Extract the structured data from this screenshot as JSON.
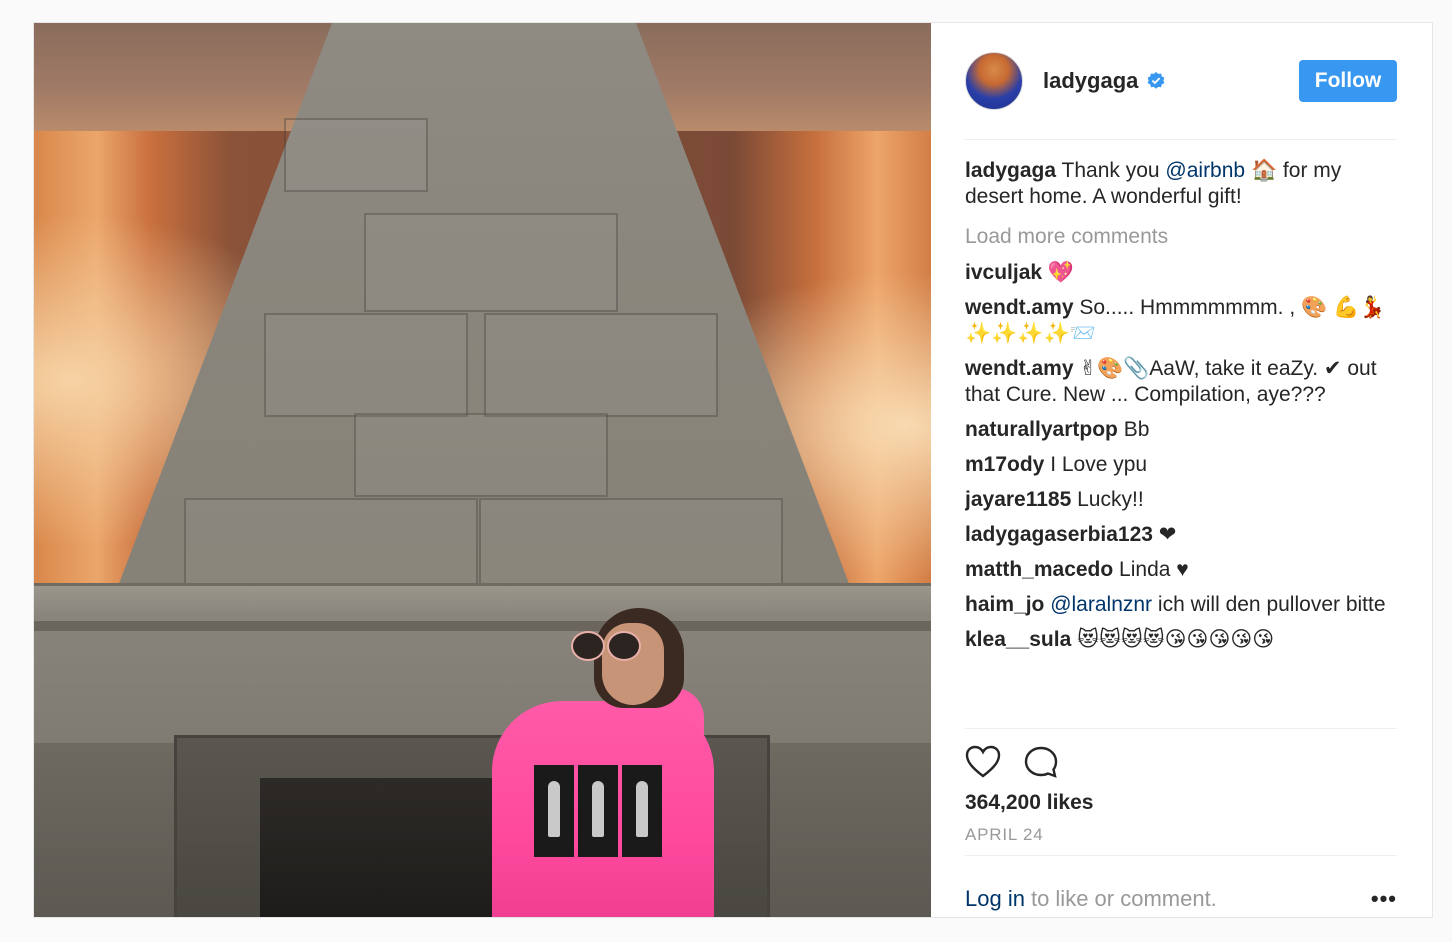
{
  "post": {
    "username": "ladygaga",
    "follow_label": "Follow"
  },
  "caption": {
    "user": "ladygaga",
    "text_before": " Thank you ",
    "mention": "@airbnb",
    "text_after": " 🏠 for my desert home. A wonderful gift!"
  },
  "load_more": "Load more comments",
  "comments": [
    {
      "user": "ivculjak",
      "text": " 💖"
    },
    {
      "user": "wendt.amy",
      "text": " So..... Hmmmmmmm. , 🎨 💪💃✨✨✨✨📨"
    },
    {
      "user": "wendt.amy",
      "text": " ✌🎨📎AaW, take it eaZy. ✔ out that Cure. New ... Compilation, aye???"
    },
    {
      "user": "naturallyartpop",
      "text": " Bb"
    },
    {
      "user": "m17ody",
      "text": " I Love ypu"
    },
    {
      "user": "jayare1185",
      "text": " Lucky!!"
    },
    {
      "user": "ladygagaserbia123",
      "text": " ❤"
    },
    {
      "user": "matth_macedo",
      "text": " Linda ♥"
    },
    {
      "user": "haim_jo",
      "mention": "@laralnznr",
      "text": " ich will den pullover bitte"
    },
    {
      "user": "klea__sula",
      "text": " 😻😻😻😻😘😘😘😘😘"
    }
  ],
  "likes": "364,200 likes",
  "date": "APRIL 24",
  "login": {
    "link": "Log in",
    "rest": "to like or comment.",
    "more": "•••"
  },
  "colors": {
    "follow_bg": "#3897f0",
    "verified": "#3897f0",
    "mention": "#003569",
    "muted": "#999999"
  },
  "icons": [
    "heart-icon",
    "comment-icon",
    "verified-icon",
    "more-options-icon"
  ]
}
